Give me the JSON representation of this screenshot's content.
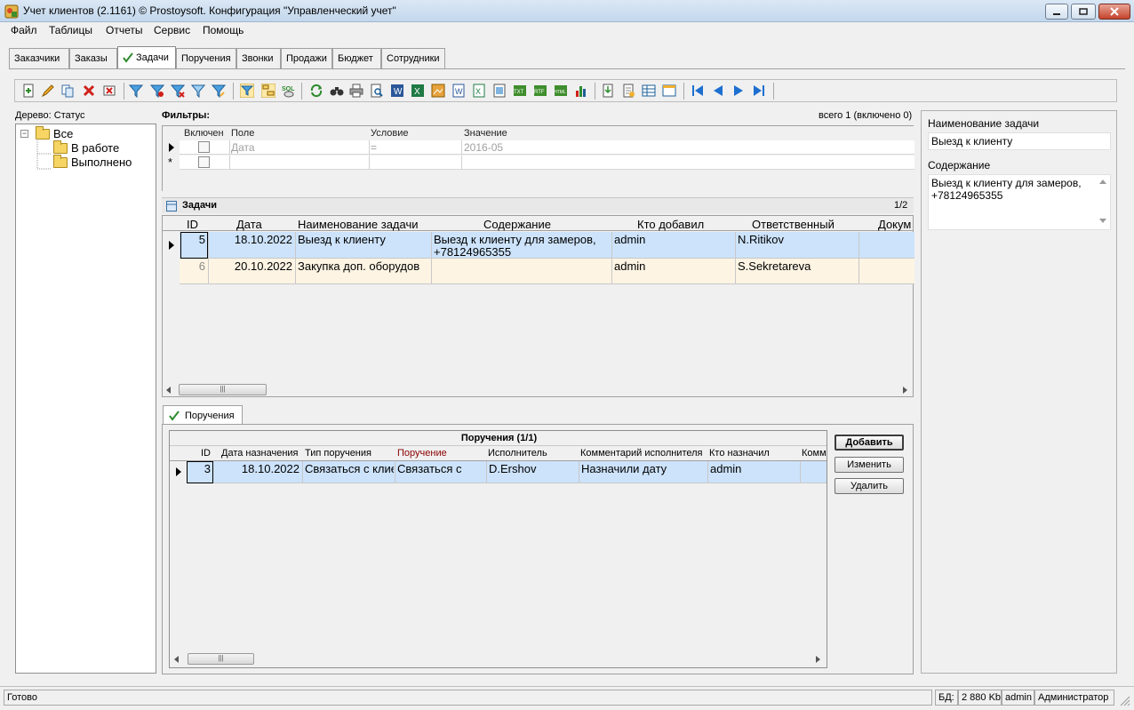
{
  "window": {
    "title": "Учет клиентов (2.1161) © Prostoysoft. Конфигурация \"Управленческий учет\""
  },
  "menu": [
    "Файл",
    "Таблицы",
    "Отчеты",
    "Сервис",
    "Помощь"
  ],
  "tabs": [
    {
      "label": "Заказчики",
      "active": false
    },
    {
      "label": "Заказы",
      "active": false
    },
    {
      "label": "Задачи",
      "active": true
    },
    {
      "label": "Поручения",
      "active": false
    },
    {
      "label": "Звонки",
      "active": false
    },
    {
      "label": "Продажи",
      "active": false
    },
    {
      "label": "Бюджет",
      "active": false
    },
    {
      "label": "Сотрудники",
      "active": false
    }
  ],
  "tree": {
    "label": "Дерево: Статус",
    "root": "Все",
    "children": [
      "В работе",
      "Выполнено"
    ]
  },
  "filters": {
    "title": "Фильтры:",
    "count": "всего 1 (включено 0)",
    "columns": [
      "Включен",
      "Поле",
      "Условие",
      "Значение"
    ],
    "rows": [
      {
        "field": "Дата",
        "condition": "=",
        "value": "2016-05"
      }
    ],
    "new_row_marker": "*"
  },
  "tasks": {
    "title": "Задачи",
    "pager": "1/2",
    "columns": [
      "ID",
      "Дата",
      "Наименование задачи",
      "Содержание",
      "Кто добавил",
      "Ответственный",
      "Докум"
    ],
    "rows": [
      {
        "id": "5",
        "date": "18.10.2022",
        "name": "Выезд к клиенту",
        "content_line1": "Выезд к клиенту для замеров,",
        "content_line2": "+78124965355",
        "added_by": "admin",
        "responsible": "N.Ritikov"
      },
      {
        "id": "6",
        "date": "20.10.2022",
        "name": "Закупка доп. оборудов",
        "content_line1": "",
        "content_line2": "",
        "added_by": "admin",
        "responsible": "S.Sekretareva"
      }
    ]
  },
  "assignments": {
    "tab_label": "Поручения",
    "caption": "Поручения (1/1)",
    "columns": [
      "ID",
      "Дата назначения",
      "Тип поручения",
      "Поручение",
      "Исполнитель",
      "Комментарий исполнителя",
      "Кто назначил",
      "Комм"
    ],
    "rows": [
      {
        "id": "3",
        "date": "18.10.2022",
        "type": "Связаться с клие",
        "task": "Связаться с",
        "executor": "D.Ershov",
        "comment": "Назначили дату",
        "assigned_by": "admin"
      }
    ],
    "buttons": {
      "add": "Добавить",
      "edit": "Изменить",
      "delete": "Удалить"
    }
  },
  "details": {
    "name_label": "Наименование задачи",
    "name_value": "Выезд к клиенту",
    "content_label": "Содержание",
    "content_value": "Выезд к клиенту для замеров, +78124965355"
  },
  "status": {
    "text": "Готово",
    "db_label": "БД:",
    "db_size": "2 880 Kb",
    "user": "admin",
    "role": "Администратор"
  },
  "colors": {
    "selected_row": "#cde3fb",
    "alt_row": "#fdf4e3",
    "required_header": "#8b0000"
  },
  "scroll_grip": "|||"
}
